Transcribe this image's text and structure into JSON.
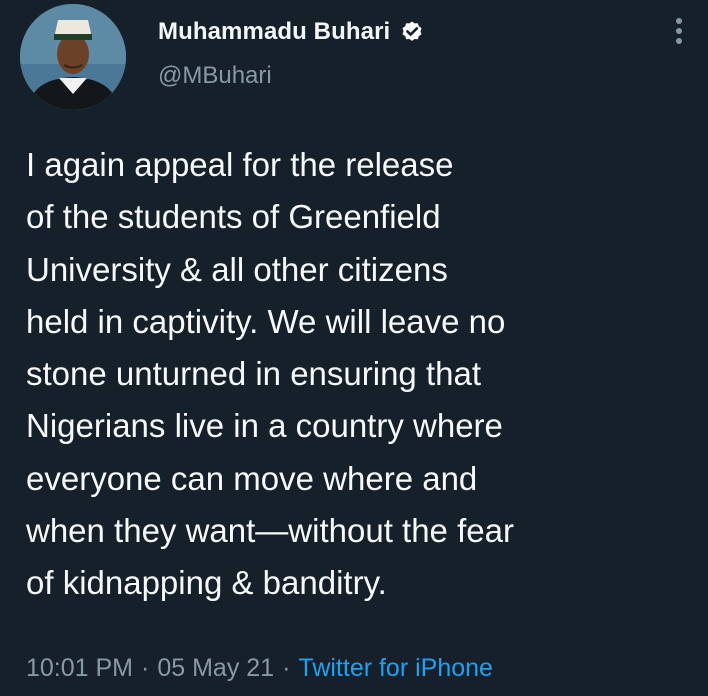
{
  "tweet": {
    "author": {
      "display_name": "Muhammadu Buhari",
      "handle": "@MBuhari",
      "verified_icon": "verified-badge-icon",
      "avatar_alt": "profile photo"
    },
    "text": "I again appeal for the release\nof the students of Greenfield\nUniversity & all other citizens\nheld in captivity. We will leave no\nstone unturned in ensuring that\nNigerians live in a country where\neveryone can move where and\nwhen they want—without the fear\nof kidnapping & banditry.",
    "time": "10:01 PM",
    "date": "05 May 21",
    "separator": "·",
    "source": "Twitter for iPhone",
    "more_icon": "vertical-dots-icon"
  },
  "colors": {
    "background": "#15202b",
    "text": "#f7f9fa",
    "muted": "#8899a6",
    "link": "#1da1f2"
  }
}
